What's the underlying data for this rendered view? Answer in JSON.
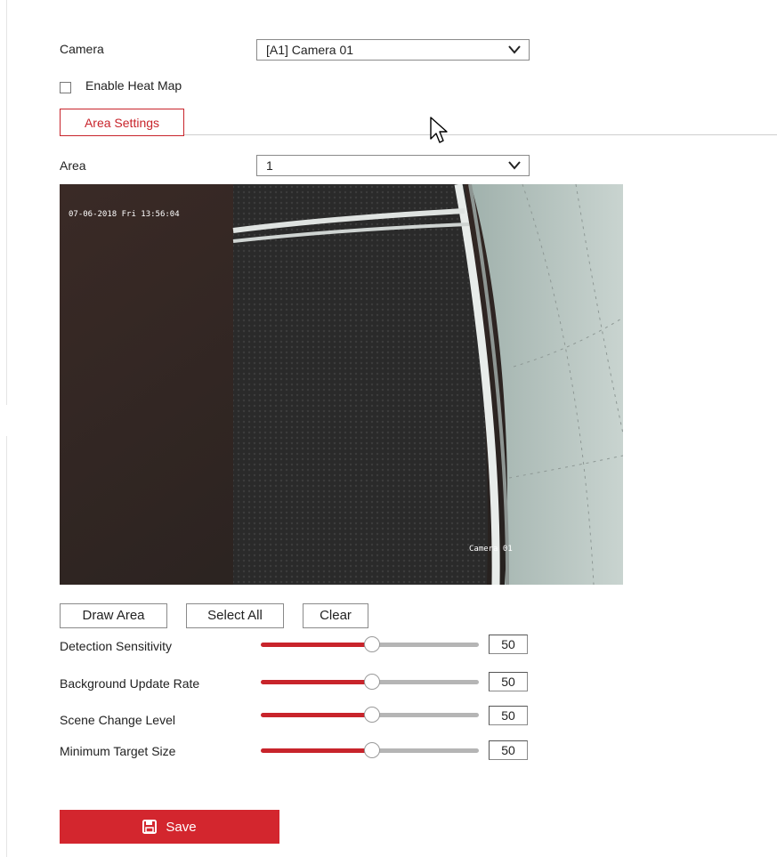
{
  "camera": {
    "label": "Camera",
    "selected": "[A1] Camera 01"
  },
  "heat_map": {
    "label": "Enable Heat Map",
    "checked": false
  },
  "tab": {
    "label": "Area Settings"
  },
  "area": {
    "label": "Area",
    "selected": "1"
  },
  "preview": {
    "osd_datetime": "07-06-2018 Fri 13:56:04",
    "osd_camera_name": "Camera 01"
  },
  "buttons": {
    "draw_area": "Draw Area",
    "select_all": "Select All",
    "clear": "Clear"
  },
  "sliders": [
    {
      "label": "Detection Sensitivity",
      "value": "50",
      "percent": 50
    },
    {
      "label": "Background Update Rate",
      "value": "50",
      "percent": 50
    },
    {
      "label": "Scene Change Level",
      "value": "50",
      "percent": 50
    },
    {
      "label": "Minimum Target Size",
      "value": "50",
      "percent": 50
    }
  ],
  "save": {
    "label": "Save",
    "icon": "floppy-disk-icon"
  },
  "colors": {
    "accent": "#c8242b",
    "track": "#b5b5b5"
  }
}
